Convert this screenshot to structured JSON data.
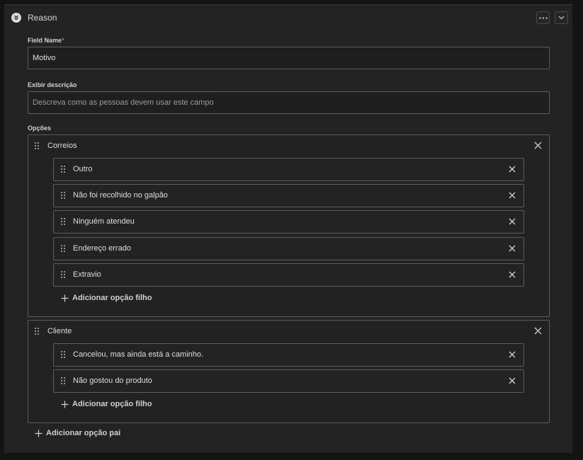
{
  "header": {
    "title": "Reason"
  },
  "field_name": {
    "label": "Field Name",
    "required_mark": "*",
    "value": "Motivo"
  },
  "description": {
    "label": "Exibir descrição",
    "placeholder": "Descreva como as pessoas devem usar este campo"
  },
  "options": {
    "label": "Opções",
    "groups": [
      {
        "name": "Correios",
        "children": [
          "Outro",
          "Não foi recolhido no galpão",
          "Ninguém atendeu",
          "Endereço errado",
          "Extravio"
        ],
        "add_child_label": "Adicionar opção filho"
      },
      {
        "name": "Cliente",
        "children": [
          "Cancelou, mas ainda está a caminho.",
          "Não gostou do produto"
        ],
        "add_child_label": "Adicionar opção filho"
      }
    ],
    "add_parent_label": "Adicionar opção pai"
  },
  "colors": {
    "background": "#232323",
    "border": "#5d5d5d",
    "required": "#e0555c"
  },
  "icons": {
    "collapse": "chevrons-down-icon",
    "more": "more-horizontal-icon",
    "expand": "chevron-down-icon",
    "drag": "drag-handle-icon",
    "remove": "close-icon",
    "add": "plus-icon"
  }
}
